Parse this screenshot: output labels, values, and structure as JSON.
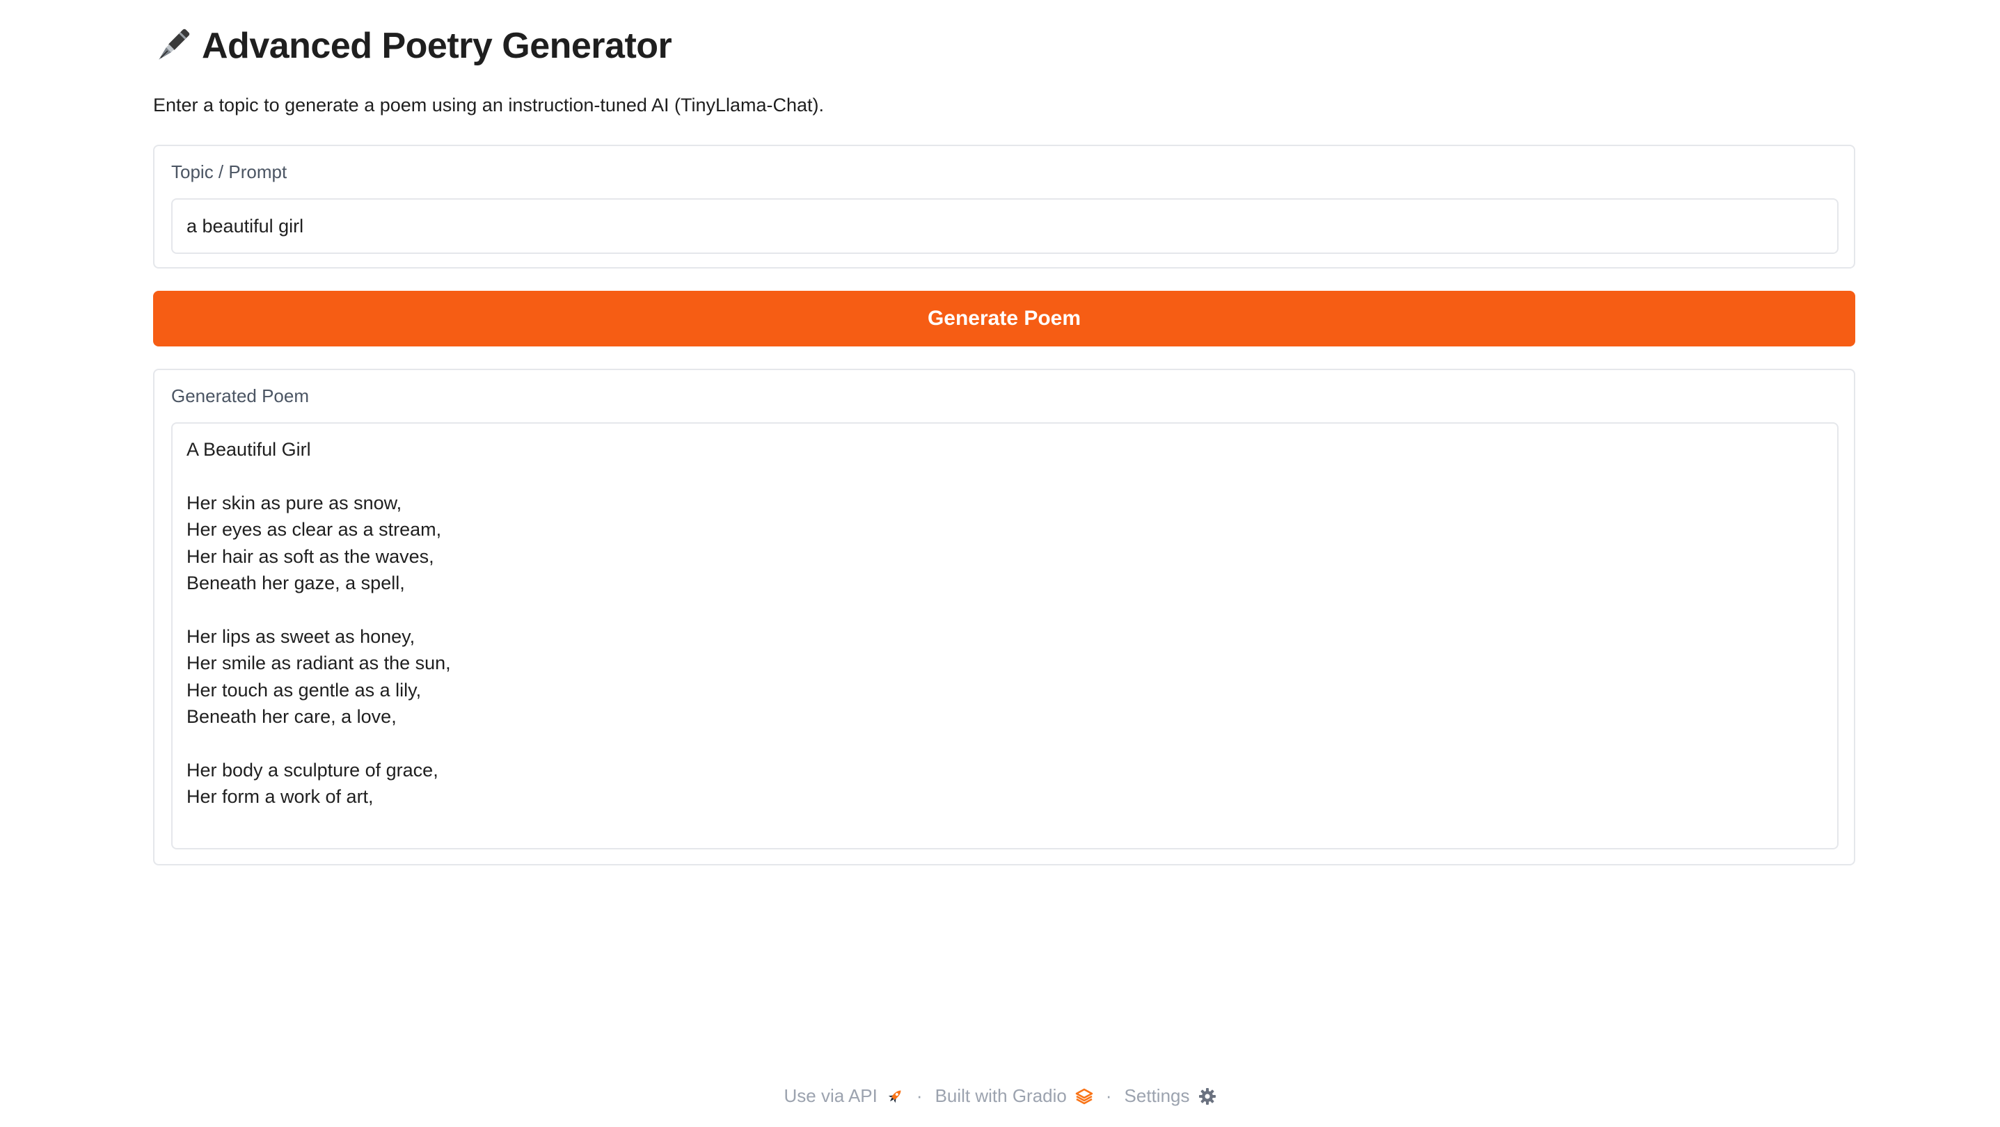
{
  "header": {
    "icon": "fountain-pen-icon",
    "title": "Advanced Poetry Generator",
    "description": "Enter a topic to generate a poem using an instruction-tuned AI (TinyLlama-Chat)."
  },
  "topic": {
    "label": "Topic / Prompt",
    "value": "a beautiful girl"
  },
  "generate": {
    "label": "Generate Poem",
    "color": "#f65d14"
  },
  "output": {
    "label": "Generated Poem",
    "lines": [
      "A Beautiful Girl",
      "",
      "Her skin as pure as snow,",
      "Her eyes as clear as a stream,",
      "Her hair as soft as the waves,",
      "Beneath her gaze, a spell,",
      "",
      "Her lips as sweet as honey,",
      "Her smile as radiant as the sun,",
      "Her touch as gentle as a lily,",
      "Beneath her care, a love,",
      "",
      "Her body a sculpture of grace,",
      "Her form a work of art,"
    ]
  },
  "footer": {
    "api_label": "Use via API",
    "api_icon": "rocket-icon",
    "separator": "·",
    "gradio_label": "Built with Gradio",
    "gradio_icon": "gradio-logo-icon",
    "settings_label": "Settings",
    "settings_icon": "gear-icon"
  }
}
